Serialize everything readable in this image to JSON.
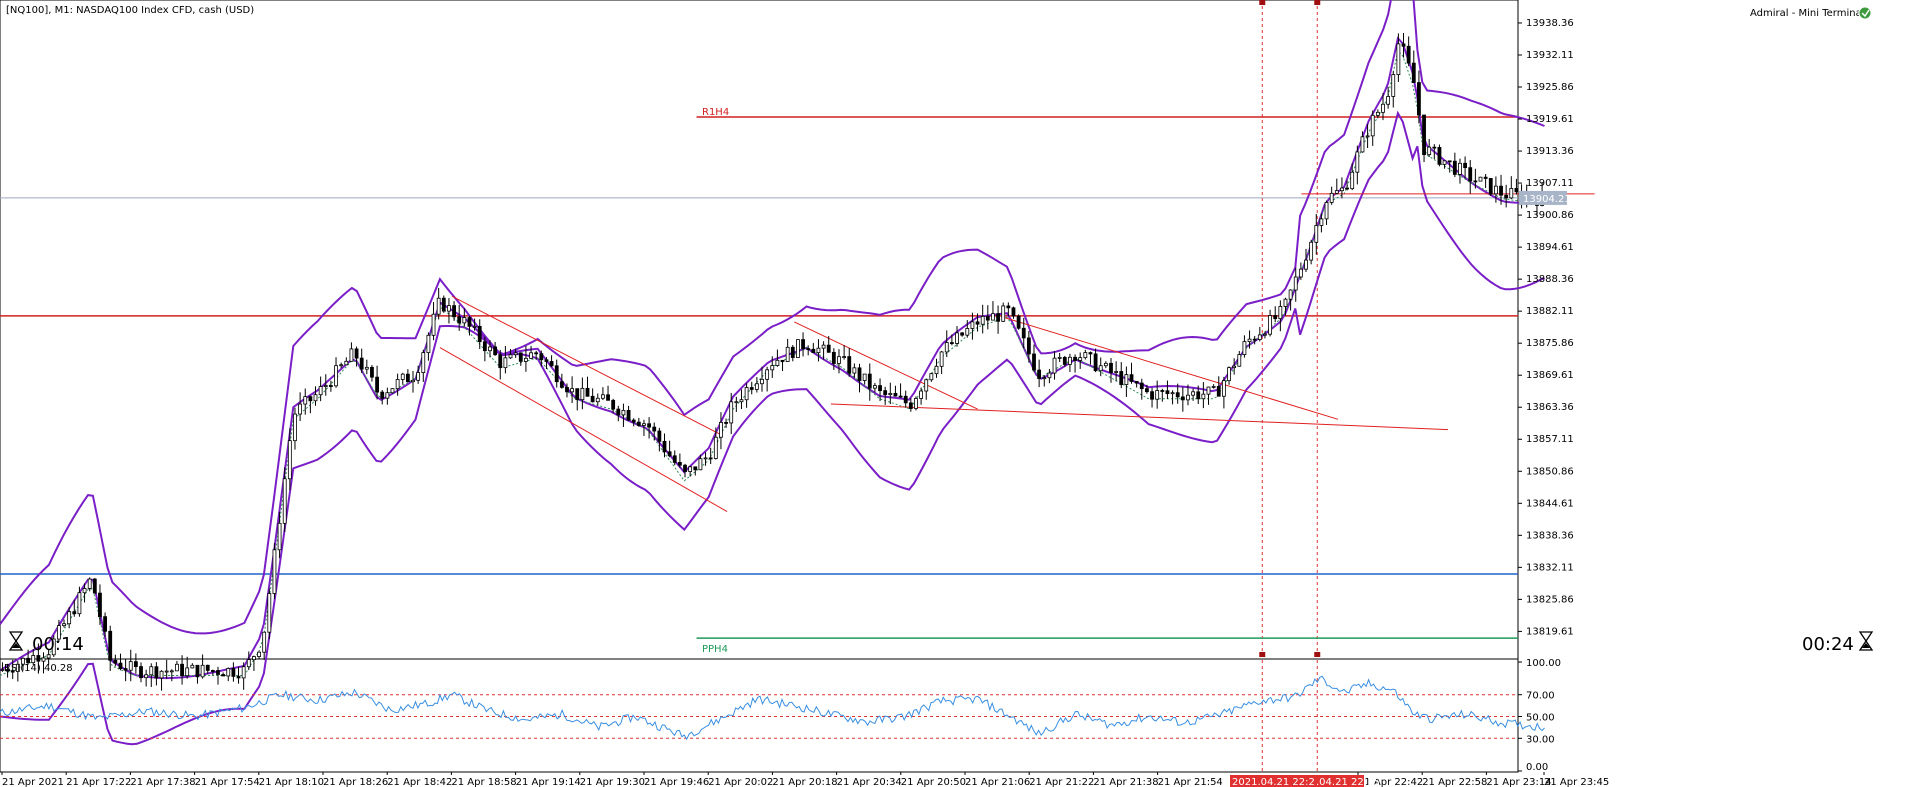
{
  "header": {
    "symbol_title": "[NQ100], M1:  NASDAQ100 Index CFD, cash (USD)",
    "terminal_label": "Admiral - Mini Terminal",
    "timer_left": "00:14",
    "timer_right": "00:24"
  },
  "levels": {
    "r1h4_label": "R1H4",
    "pph4_label": "PPH4",
    "current_price": "13904.21"
  },
  "rsi": {
    "label": "RSI(14) 40.28",
    "ticks": [
      "100.00",
      "70.00",
      "50.00",
      "30.00",
      "0.00"
    ]
  },
  "highlight_times": [
    "2021.04.21 22:21",
    ".04.21 22:35"
  ],
  "colors": {
    "candle_up": "#000000",
    "candle_down": "#000000",
    "bands": "#7a1fc7",
    "sma": "#2e8b57",
    "resistance": "#d02020",
    "support": "#1f63c8",
    "pivot": "#1f9a5a",
    "rsi_line": "#3a8fe0",
    "rsi_levels": "#e03030",
    "highlight": "#e03030"
  },
  "chart_data": {
    "type": "candlestick",
    "symbol": "NQ100",
    "timeframe": "M1",
    "ylim": [
      13815.0,
      13940.5
    ],
    "y_ticks": [
      13938.36,
      13932.11,
      13925.86,
      13919.61,
      13913.36,
      13907.11,
      13900.86,
      13894.61,
      13888.36,
      13882.11,
      13875.86,
      13869.61,
      13863.36,
      13857.11,
      13850.86,
      13844.61,
      13838.36,
      13832.11,
      13825.86,
      13819.61
    ],
    "x_labels": [
      "21 Apr 2021",
      "21 Apr 17:22",
      "21 Apr 17:38",
      "21 Apr 17:54",
      "21 Apr 18:10",
      "21 Apr 18:26",
      "21 Apr 18:42",
      "21 Apr 18:58",
      "21 Apr 19:14",
      "21 Apr 19:30",
      "21 Apr 19:46",
      "21 Apr 20:02",
      "21 Apr 20:18",
      "21 Apr 20:34",
      "21 Apr 20:50",
      "21 Apr 21:06",
      "21 Apr 21:22",
      "21 Apr 21:38",
      "21 Apr 21:54",
      "21 Apr 22:42",
      "21 Apr 22:58",
      "21 Apr 23:14",
      "21 Apr 23:45"
    ],
    "price_path": [
      [
        0,
        13812
      ],
      [
        40,
        13816
      ],
      [
        75,
        13830
      ],
      [
        90,
        13814
      ],
      [
        110,
        13812
      ],
      [
        200,
        13812
      ],
      [
        215,
        13818
      ],
      [
        225,
        13835
      ],
      [
        240,
        13862
      ],
      [
        260,
        13866
      ],
      [
        290,
        13874
      ],
      [
        310,
        13866
      ],
      [
        340,
        13870
      ],
      [
        360,
        13884
      ],
      [
        380,
        13880
      ],
      [
        410,
        13872
      ],
      [
        440,
        13874
      ],
      [
        470,
        13866
      ],
      [
        500,
        13864
      ],
      [
        530,
        13860
      ],
      [
        560,
        13850
      ],
      [
        580,
        13854
      ],
      [
        600,
        13864
      ],
      [
        630,
        13872
      ],
      [
        660,
        13876
      ],
      [
        690,
        13872
      ],
      [
        720,
        13866
      ],
      [
        745,
        13864
      ],
      [
        770,
        13874
      ],
      [
        800,
        13880
      ],
      [
        825,
        13882
      ],
      [
        850,
        13870
      ],
      [
        880,
        13874
      ],
      [
        910,
        13870
      ],
      [
        940,
        13866
      ],
      [
        970,
        13866
      ],
      [
        995,
        13866
      ],
      [
        1020,
        13876
      ],
      [
        1050,
        13882
      ],
      [
        1070,
        13894
      ],
      [
        1085,
        13904
      ],
      [
        1100,
        13906
      ],
      [
        1120,
        13918
      ],
      [
        1135,
        13924
      ],
      [
        1145,
        13935
      ],
      [
        1158,
        13926
      ],
      [
        1165,
        13914
      ],
      [
        1185,
        13911
      ],
      [
        1205,
        13908
      ],
      [
        1230,
        13905
      ],
      [
        1265,
        13904
      ]
    ],
    "resistance_level": 13881.2,
    "support_level": 13830.8,
    "r1h4_level": 13920.0,
    "pph4_level": 13818.3,
    "current_level": 13904.21,
    "rsi": {
      "levels": [
        70,
        50,
        30
      ],
      "ylim": [
        0,
        100
      ],
      "path": [
        [
          0,
          53
        ],
        [
          40,
          60
        ],
        [
          80,
          48
        ],
        [
          120,
          55
        ],
        [
          160,
          50
        ],
        [
          200,
          58
        ],
        [
          230,
          70
        ],
        [
          260,
          65
        ],
        [
          290,
          72
        ],
        [
          320,
          56
        ],
        [
          350,
          62
        ],
        [
          370,
          70
        ],
        [
          400,
          55
        ],
        [
          430,
          47
        ],
        [
          460,
          52
        ],
        [
          490,
          40
        ],
        [
          520,
          50
        ],
        [
          560,
          32
        ],
        [
          590,
          48
        ],
        [
          620,
          66
        ],
        [
          650,
          60
        ],
        [
          680,
          52
        ],
        [
          710,
          45
        ],
        [
          740,
          50
        ],
        [
          770,
          64
        ],
        [
          800,
          66
        ],
        [
          830,
          48
        ],
        [
          850,
          34
        ],
        [
          880,
          52
        ],
        [
          910,
          42
        ],
        [
          940,
          50
        ],
        [
          970,
          44
        ],
        [
          1000,
          52
        ],
        [
          1030,
          64
        ],
        [
          1060,
          68
        ],
        [
          1080,
          85
        ],
        [
          1100,
          72
        ],
        [
          1120,
          80
        ],
        [
          1140,
          74
        ],
        [
          1158,
          52
        ],
        [
          1170,
          48
        ],
        [
          1200,
          52
        ],
        [
          1230,
          44
        ],
        [
          1265,
          40
        ]
      ]
    }
  }
}
